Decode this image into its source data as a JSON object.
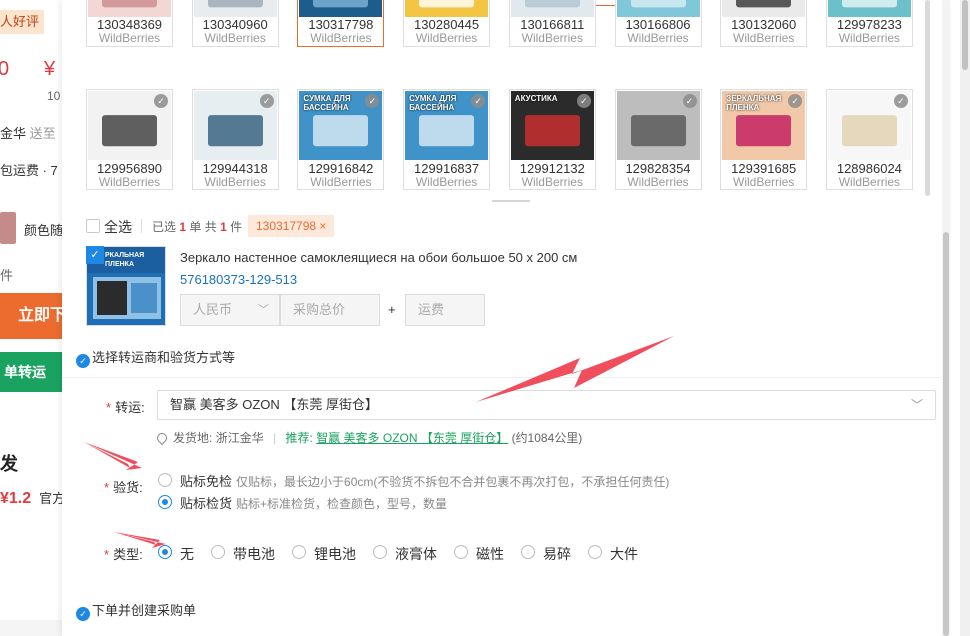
{
  "background": {
    "badge": "人好评",
    "price_left": "0",
    "price_yen": "¥",
    "small_num": "10",
    "location": "金华",
    "location_suffix": "送至",
    "shipping": "包运费 · 7",
    "color_label": "颜色随",
    "piece": "件",
    "buy_button": "立即下",
    "order_button": "单转运",
    "fa_heading": "发",
    "price2": "¥1.2",
    "price2_suffix": "官方"
  },
  "grid": {
    "top_row": [
      {
        "id": "130348369",
        "source": "WildBerries"
      },
      {
        "id": "130340960",
        "source": "WildBerries"
      },
      {
        "id": "130317798",
        "source": "WildBerries",
        "selected": true
      },
      {
        "id": "130280445",
        "source": "WildBerries"
      },
      {
        "id": "130166811",
        "source": "WildBerries"
      },
      {
        "id": "130166806",
        "source": "WildBerries"
      },
      {
        "id": "130132060",
        "source": "WildBerries"
      },
      {
        "id": "129978233",
        "source": "WildBerries"
      }
    ],
    "bottom_row": [
      {
        "id": "129956890",
        "source": "WildBerries"
      },
      {
        "id": "129944318",
        "source": "WildBerries"
      },
      {
        "id": "129916842",
        "source": "WildBerries",
        "img_text": "СУМКА ДЛЯ БАССЕЙНА"
      },
      {
        "id": "129916837",
        "source": "WildBerries",
        "img_text": "СУМКА ДЛЯ БАССЕЙНА"
      },
      {
        "id": "129912132",
        "source": "WildBerries",
        "img_text": "АКУСТИКА"
      },
      {
        "id": "129828354",
        "source": "WildBerries"
      },
      {
        "id": "129391685",
        "source": "WildBerries",
        "img_text": "ЗЕРКАЛЬНАЯ ПЛЕНКА"
      },
      {
        "id": "128986024",
        "source": "WildBerries"
      }
    ]
  },
  "selection": {
    "select_all": "全选",
    "summary_prefix": "已选",
    "summary_count1": "1",
    "summary_mid": "单 共",
    "summary_count2": "1",
    "summary_suffix": "件",
    "tag": "130317798",
    "tag_close": "×"
  },
  "product": {
    "img_text": "РКАЛЬНАЯ ПЛЕНКА",
    "title": "Зеркало настенное самоклеящиеся на обои большое 50 x 200 см",
    "sku": "576180373-129-513",
    "currency": "人民币",
    "total_placeholder": "采购总价",
    "plus": "+",
    "freight_placeholder": "运费"
  },
  "section1": {
    "title": "选择转运商和验货方式等"
  },
  "form": {
    "transport_label": "转运:",
    "transport_value": "智赢 美客多 OZON 【东莞 厚街仓】",
    "origin_label": "发货地:",
    "origin_value": "浙江金华",
    "recommend_label": "推荐:",
    "recommend_value": "智赢 美客多 OZON 【东莞 厚街仓】",
    "distance": "(约1084公里)",
    "inspection_label": "验货:",
    "inspection_options": [
      {
        "label": "贴标免检",
        "desc": "仅贴标，最长边小于60cm(不验货不拆包不合并包裹不再次打包，不承担任何责任)",
        "selected": false
      },
      {
        "label": "贴标检货",
        "desc": "贴标+标准检货，检查颜色，型号，数量",
        "selected": true
      }
    ],
    "type_label": "类型:",
    "type_options": [
      {
        "label": "无",
        "selected": true
      },
      {
        "label": "带电池",
        "selected": false
      },
      {
        "label": "锂电池",
        "selected": false
      },
      {
        "label": "液膏体",
        "selected": false
      },
      {
        "label": "磁性",
        "selected": false
      },
      {
        "label": "易碎",
        "selected": false
      },
      {
        "label": "大件",
        "selected": false
      }
    ]
  },
  "section2": {
    "title": "下单并创建采购单"
  },
  "colors": {
    "accent": "#1e88e5",
    "orange": "#ec6b2e",
    "red": "#e4393c",
    "green": "#1aa260",
    "arrow": "#f04d5d"
  }
}
